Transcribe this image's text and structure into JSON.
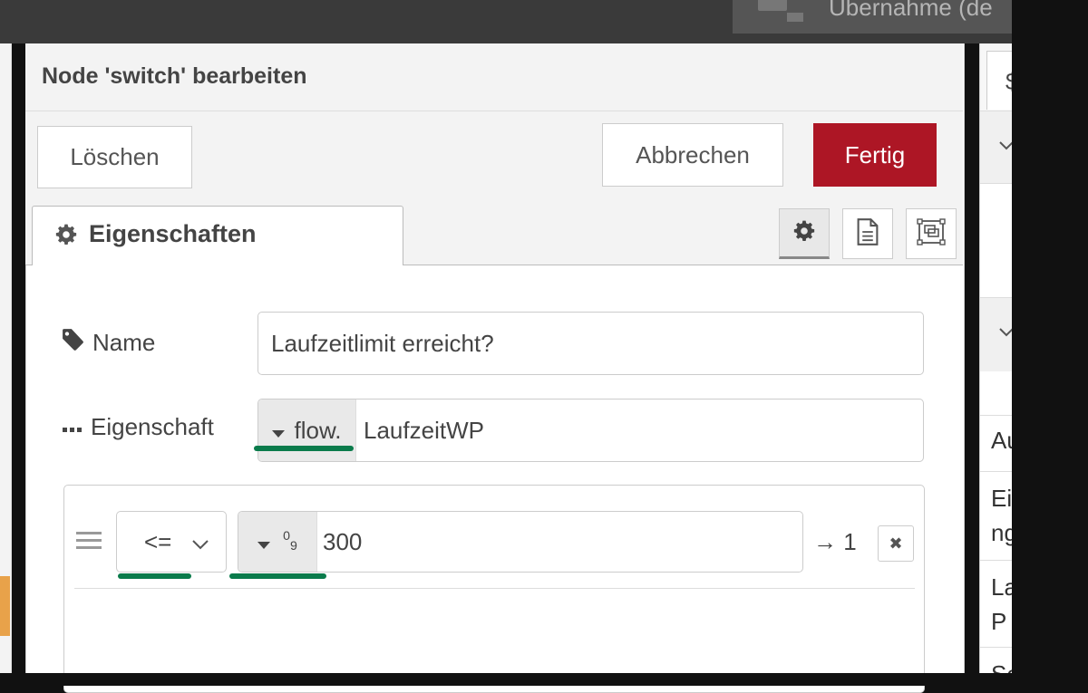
{
  "topbar": {
    "deploy_label": "Übernahme (de"
  },
  "tray": {
    "title": "Node 'switch' bearbeiten",
    "buttons": {
      "delete": "Löschen",
      "cancel": "Abbrechen",
      "done": "Fertig"
    },
    "done_color": "#ad1625"
  },
  "tabs": {
    "properties_label": "Eigenschaften",
    "icons": [
      "gear-icon",
      "document-icon",
      "appearance-icon"
    ]
  },
  "form": {
    "name": {
      "label": "Name",
      "value": "Laufzeitlimit erreicht?"
    },
    "property": {
      "label": "Eigenschaft",
      "type": "flow.",
      "value": "LaufzeitWP"
    },
    "rule": {
      "operator": "<=",
      "value_type_glyph": "0",
      "value_type_glyph_sub": "9",
      "value": "300",
      "output": "→ 1",
      "remove_glyph": "✖"
    },
    "focus_color": "#0a7b4b"
  },
  "sidebar": {
    "tab_glyph": "$",
    "rows": [
      "Au",
      "Ei",
      "ng",
      "La",
      "P",
      "Sc"
    ]
  }
}
